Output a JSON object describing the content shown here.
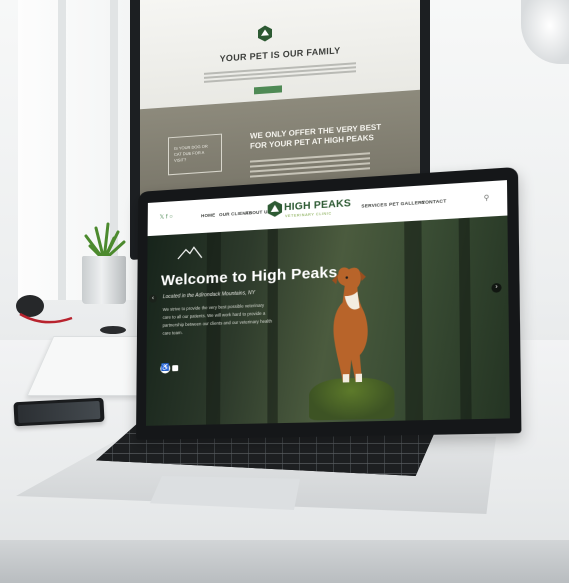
{
  "monitor_site": {
    "title": "YOUR PET IS OUR FAMILY",
    "box_text": "IS YOUR DOG OR CAT DUE FOR A VISIT?",
    "headline": "WE ONLY OFFER THE VERY BEST FOR YOUR PET AT HIGH PEAKS"
  },
  "laptop_site": {
    "nav_left": [
      "HOME",
      "OUR CLIENTS",
      "ABOUT US"
    ],
    "nav_right": [
      "SERVICES",
      "PET GALLERY",
      "CONTACT"
    ],
    "logo_name": "HIGH PEAKS",
    "logo_sub": "VETERINARY CLINIC",
    "headline": "Welcome to High Peaks",
    "subheadline": "Located in the Adirondack Mountains, NY",
    "body": "We strive to provide the very best possible veterinary care to all our patients. We will work hard to provide a partnership between our clients and our veterinary health care team.",
    "brand_green": "#2d5a33",
    "accent_green": "#6c9b2f"
  },
  "icons": [
    "twitter-icon",
    "facebook-icon",
    "instagram-icon",
    "search-icon",
    "arrow-left-icon",
    "arrow-right-icon",
    "accessibility-icon"
  ]
}
